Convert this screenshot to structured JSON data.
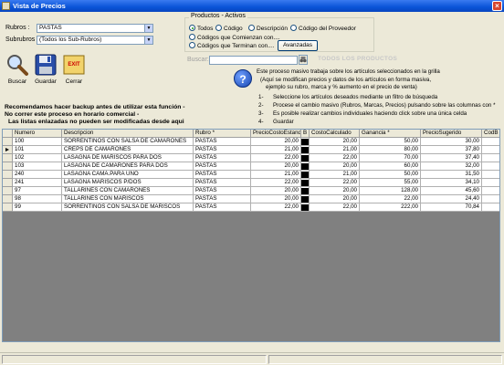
{
  "window": {
    "title": "Vista de Precios"
  },
  "filters": {
    "rubros_label": "Rubros :",
    "rubros_value": "PASTAS",
    "subrubros_label": "Subrubros :",
    "subrubros_value": "(Todos los Sub-Rubros)"
  },
  "toolbar": {
    "buscar": "Buscar",
    "guardar": "Guardar",
    "cerrar": "Cerrar",
    "exit_text": "EXIT"
  },
  "productos": {
    "title": "Productos - Activos",
    "options": [
      "Todos",
      "Código",
      "Descripción",
      "Código del Proveedor",
      "Códigos que Comienzan con....",
      "Códigos que Terminan con...."
    ],
    "selected": "Todos",
    "avanzadas": "Avanzadas"
  },
  "search": {
    "label": "Buscar:",
    "value": "",
    "status": "TODOS LOS PRODUCTOS"
  },
  "info": {
    "line1": "Este proceso masivo trabaja sobre los artículos seleccionados en la grilla",
    "line2": "(Aquí se modifican precios y datos de los artículos en forma masiva,",
    "line3": "ejemplo su rubro, marca y % aumento en el precio de venta)",
    "steps": [
      {
        "n": "1-",
        "text": "Seleccione los artículos deseados mediante un filtro de búsqueda"
      },
      {
        "n": "2-",
        "text": "Procese el cambio masivo (Rubros, Marcas, Precios) pulsando sobre las columnas con *"
      },
      {
        "n": "3-",
        "text": "Es posible realizar cambios individuales haciendo click sobre una única celda"
      },
      {
        "n": "4-",
        "text": "Guardar"
      }
    ]
  },
  "warnings": [
    "Recomendamos hacer backup antes de utilizar esta función -",
    "No correr este proceso en horario comercial -",
    "Las listas enlazadas no pueden ser modificadas desde aqui"
  ],
  "grid": {
    "columns": [
      "Numero",
      "Descripcion",
      "Rubro *",
      "PrecioCostoEstandar",
      "B",
      "CostoCalculado",
      "Ganancia *",
      "PrecioSugerido",
      "CodB"
    ],
    "rows": [
      [
        "100",
        "SORRENTINOS CON SALSA DE CAMARONES",
        "PASTAS",
        "20,00",
        "20,00",
        "50,00",
        "30,00"
      ],
      [
        "101",
        "CREPS DE CAMARONES",
        "PASTAS",
        "21,00",
        "21,00",
        "80,00",
        "37,80"
      ],
      [
        "102",
        "LASAGNA DE MARISCOS PARA DOS",
        "PASTAS",
        "22,00",
        "22,00",
        "70,00",
        "37,40"
      ],
      [
        "103",
        "LASAGNA DE CAMARONES PARA DOS",
        "PASTAS",
        "20,00",
        "20,00",
        "60,00",
        "32,00"
      ],
      [
        "240",
        "LASAGNA CAMA.PARA UNO",
        "PASTAS",
        "21,00",
        "21,00",
        "50,00",
        "31,50"
      ],
      [
        "241",
        "LASAGNA MARISCOS P/DOS",
        "PASTAS",
        "22,00",
        "22,00",
        "55,00",
        "34,10"
      ],
      [
        "97",
        "TALLARINES CON CAMARONES",
        "PASTAS",
        "20,00",
        "20,00",
        "128,00",
        "45,60"
      ],
      [
        "98",
        "TALLARINES CON MARISCOS",
        "PASTAS",
        "20,00",
        "20,00",
        "22,00",
        "24,40"
      ],
      [
        "99",
        "SORRENTINOS CON SALSA DE MARISCOS",
        "PASTAS",
        "22,00",
        "22,00",
        "222,00",
        "70,84"
      ]
    ],
    "current_row": 1
  }
}
